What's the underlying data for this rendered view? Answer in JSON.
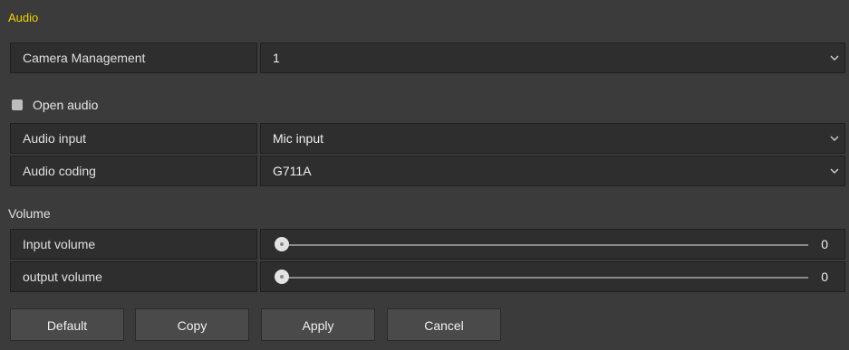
{
  "section": {
    "title": "Audio"
  },
  "camera_management": {
    "label": "Camera Management",
    "value": "1"
  },
  "open_audio": {
    "label": "Open audio",
    "checked": false
  },
  "audio_input": {
    "label": "Audio input",
    "value": "Mic input"
  },
  "audio_coding": {
    "label": "Audio coding",
    "value": "G711A"
  },
  "volume": {
    "title": "Volume",
    "input": {
      "label": "Input volume",
      "value": "0"
    },
    "output": {
      "label": "output volume",
      "value": "0"
    }
  },
  "buttons": {
    "default": "Default",
    "copy": "Copy",
    "apply": "Apply",
    "cancel": "Cancel"
  },
  "icons": {
    "dropdown": "chevron-down-icon"
  },
  "colors": {
    "accent": "#f2d400",
    "background": "#3b3b3b",
    "field": "#2e2e2e"
  }
}
